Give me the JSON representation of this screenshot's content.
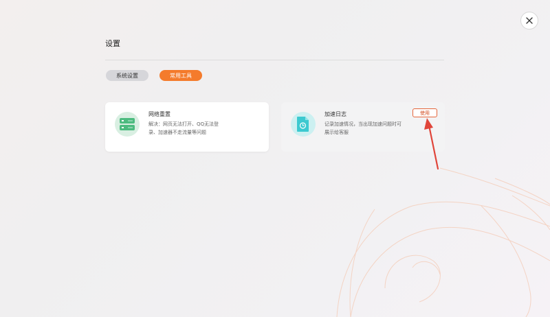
{
  "page": {
    "title": "设置"
  },
  "tabs": [
    {
      "label": "系统设置",
      "active": false
    },
    {
      "label": "常用工具",
      "active": true
    }
  ],
  "tools": [
    {
      "title": "网络重置",
      "description": "解决：网页无法打开、QQ无法登录、加速器不走流量等问题",
      "icon": "server-icon"
    },
    {
      "title": "加速日志",
      "description": "记录加速情况，当出现加速问题时可展示给客服",
      "icon": "document-clock-icon",
      "action_label": "使用"
    }
  ],
  "colors": {
    "accent": "#f47b2c",
    "annotation_arrow": "#e0453a",
    "green_icon": "#4cbb7f",
    "cyan_icon": "#3cc9d0"
  }
}
